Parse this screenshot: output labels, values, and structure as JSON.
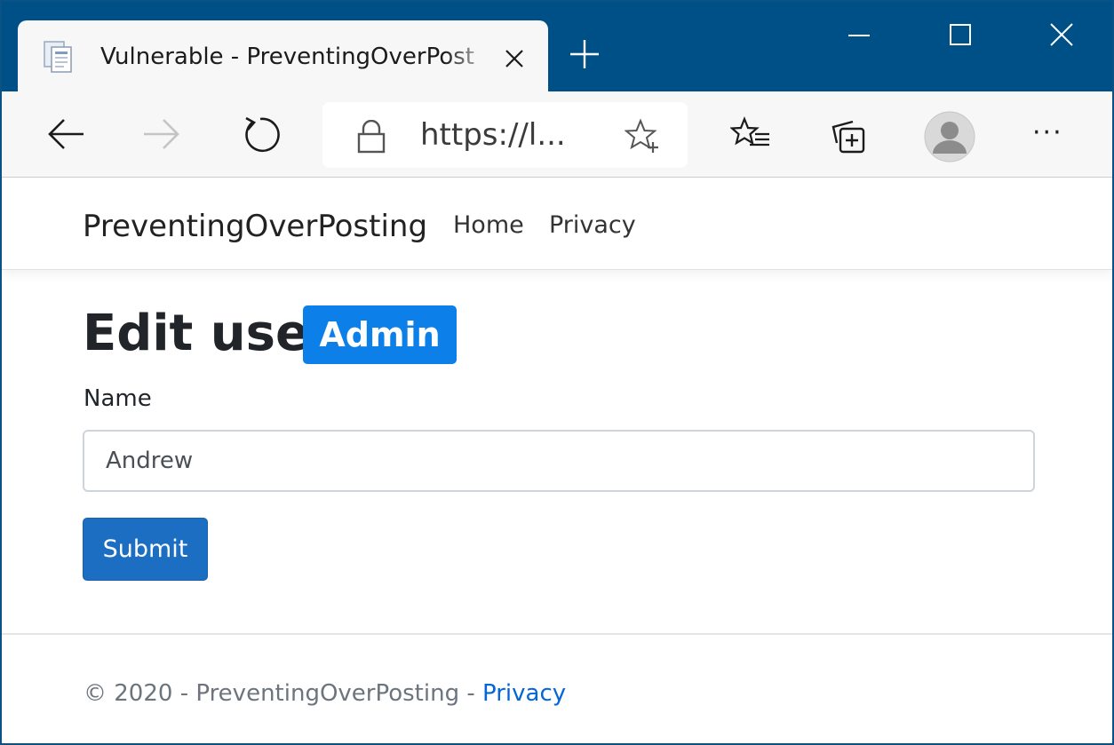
{
  "browser": {
    "tab": {
      "title": "Vulnerable - PreventingOverPost"
    },
    "address": {
      "url": "https://l..."
    },
    "icons": {
      "favicon": "document-favicon-icon",
      "tab_close": "close-icon",
      "new_tab": "plus-icon",
      "minimize": "minimize-icon",
      "maximize": "maximize-icon",
      "window_close": "close-icon",
      "back": "arrow-left-icon",
      "forward": "arrow-right-icon",
      "reload": "reload-icon",
      "lock": "lock-icon",
      "add_favorite": "star-add-icon",
      "favorites": "favorites-list-icon",
      "collections": "collections-icon",
      "profile": "profile-avatar-icon",
      "more": "more-icon"
    },
    "more_label": "···",
    "colors": {
      "titlebar": "#005088",
      "toolbar": "#f7f7f7"
    }
  },
  "site": {
    "brand": "PreventingOverPosting",
    "nav": [
      {
        "label": "Home"
      },
      {
        "label": "Privacy"
      }
    ]
  },
  "main": {
    "heading": "Edit user",
    "badge": "Admin",
    "form": {
      "name_label": "Name",
      "name_value": "Andrew",
      "submit_label": "Submit"
    },
    "colors": {
      "badge": "#0d7fe9",
      "submit": "#1b6ec2"
    }
  },
  "footer": {
    "text": "© 2020 - PreventingOverPosting - ",
    "link": "Privacy",
    "colors": {
      "link": "#0366d6"
    }
  }
}
